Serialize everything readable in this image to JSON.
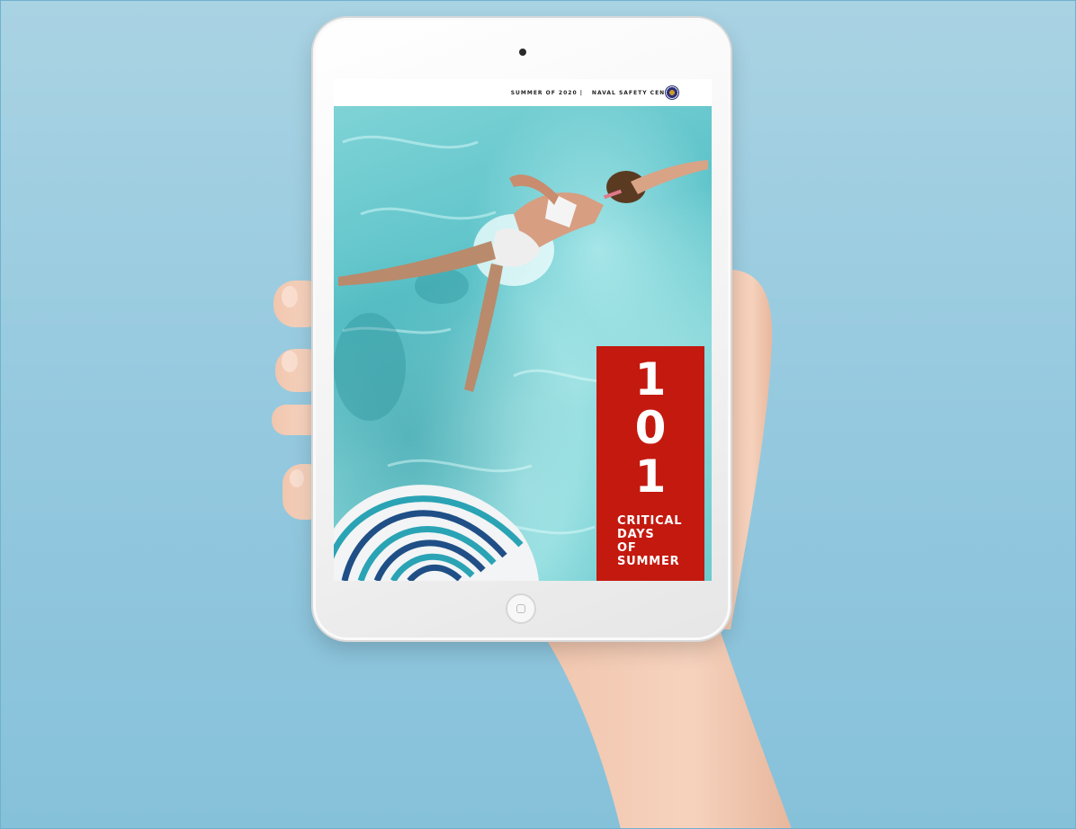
{
  "ebook": {
    "header": {
      "edition": "SUMMER OF 2020 |",
      "organization": "NAVAL SAFETY CENTER"
    },
    "title_number": [
      "1",
      "0",
      "1"
    ],
    "subtitle_lines": [
      "CRITICAL",
      "DAYS",
      "OF",
      "SUMMER"
    ]
  },
  "colors": {
    "background": "#95c9df",
    "title_block": "#c4190f",
    "pool_water": "#6ccbcf",
    "float_stripe_dark": "#1f4f86",
    "float_stripe_teal": "#2aa3b5"
  },
  "icons": {
    "seal": "naval-safety-center-seal-icon"
  }
}
